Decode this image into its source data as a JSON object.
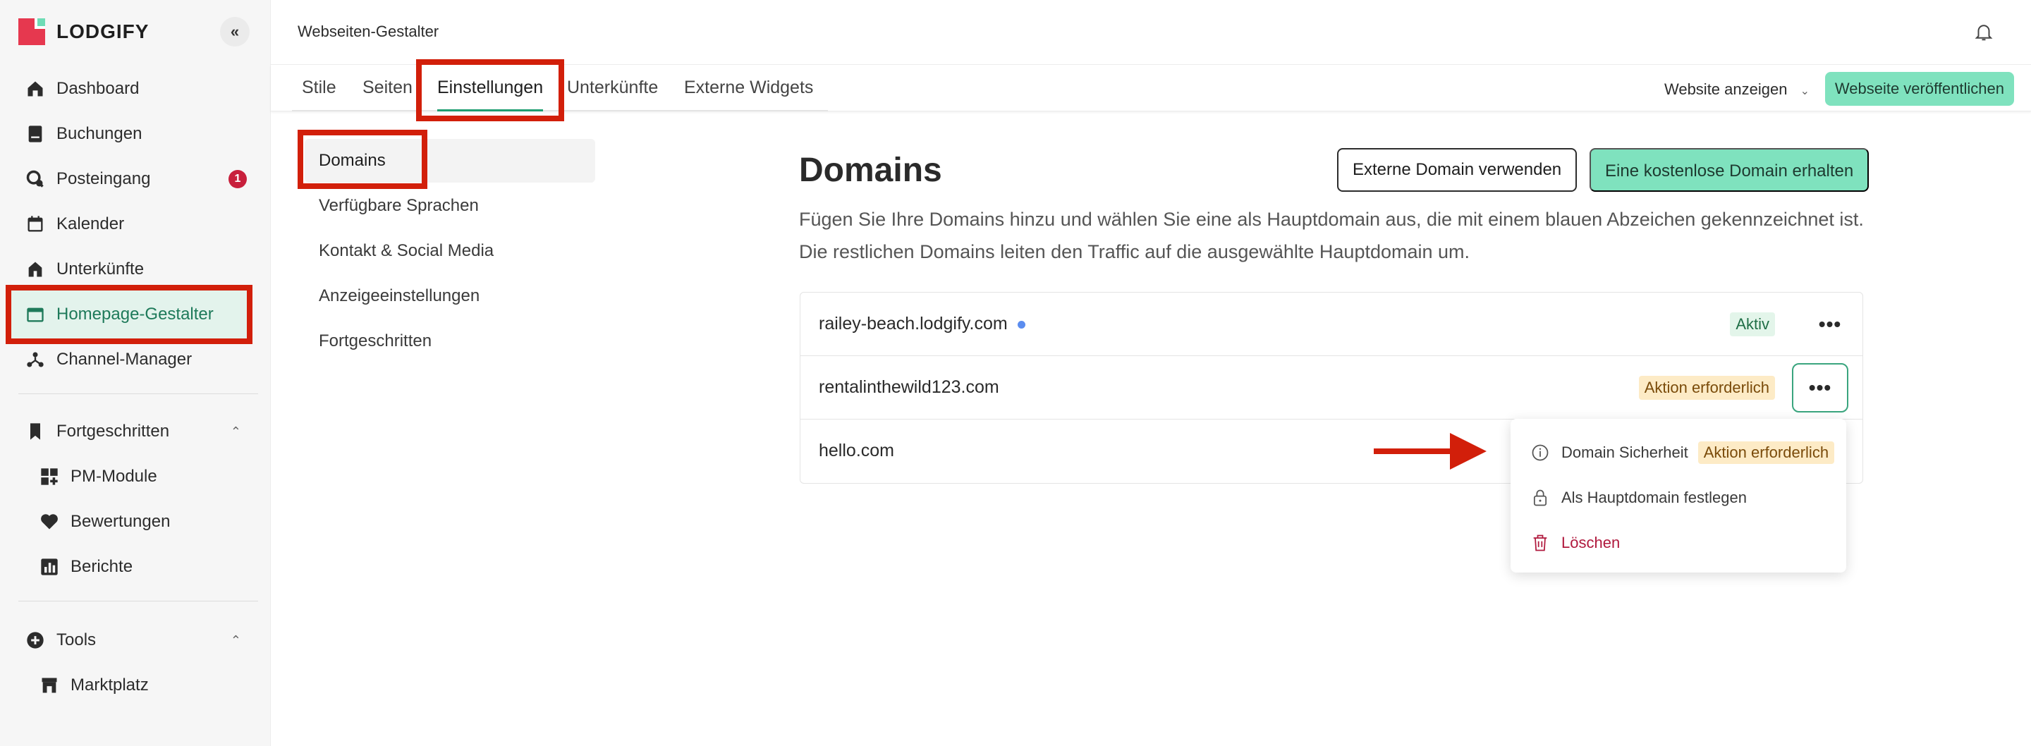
{
  "app": {
    "logo_text": "LODGIFY",
    "brand_colors": {
      "red": "#e6384f",
      "green": "#7fe2be",
      "highlight": "#d21f0a"
    }
  },
  "sidebar": {
    "collapse_icon": "chevrons-left-icon",
    "items": [
      {
        "label": "Dashboard",
        "icon": "home-icon"
      },
      {
        "label": "Buchungen",
        "icon": "book-icon"
      },
      {
        "label": "Posteingang",
        "icon": "chat-icon",
        "badge": "1"
      },
      {
        "label": "Kalender",
        "icon": "calendar-icon"
      },
      {
        "label": "Unterkünfte",
        "icon": "house-icon"
      },
      {
        "label": "Homepage-Gestalter",
        "icon": "browser-icon",
        "active": true
      },
      {
        "label": "Channel-Manager",
        "icon": "network-icon"
      }
    ],
    "sections": [
      {
        "label": "Fortgeschritten",
        "icon": "bookmark-icon",
        "items": [
          {
            "label": "PM-Module",
            "icon": "grid-plus-icon"
          },
          {
            "label": "Bewertungen",
            "icon": "heart-icon"
          },
          {
            "label": "Berichte",
            "icon": "bar-chart-icon"
          }
        ]
      },
      {
        "label": "Tools",
        "icon": "plus-circle-icon",
        "items": [
          {
            "label": "Marktplatz",
            "icon": "store-icon"
          }
        ]
      }
    ]
  },
  "header": {
    "page_name": "Webseiten-Gestalter",
    "tabs": [
      "Stile",
      "Seiten",
      "Einstellungen",
      "Unterkünfte",
      "Externe Widgets"
    ],
    "active_tab": "Einstellungen",
    "view_site_label": "Website anzeigen",
    "publish_label": "Webseite veröffentlichen"
  },
  "settings_nav": {
    "items": [
      "Domains",
      "Verfügbare Sprachen",
      "Kontakt & Social Media",
      "Anzeigeeinstellungen",
      "Fortgeschritten"
    ],
    "active": "Domains"
  },
  "main": {
    "title": "Domains",
    "external_domain_label": "Externe Domain verwenden",
    "free_domain_label": "Eine kostenlose Domain erhalten",
    "description": "Fügen Sie Ihre Domains hinzu und wählen Sie eine als Hauptdomain aus, die mit einem blauen Abzeichen gekennzeichnet ist. Die restlichen Domains leiten den Traffic auf die ausgewählte Hauptdomain um.",
    "domains": [
      {
        "name": "railey-beach.lodgify.com",
        "primary": true,
        "status": "Aktiv"
      },
      {
        "name": "rentalinthewild123.com",
        "status": "Aktion erforderlich"
      },
      {
        "name": "hello.com"
      }
    ]
  },
  "menu": {
    "items": [
      {
        "label": "Domain Sicherheit",
        "icon": "info-circle-icon",
        "badge": "Aktion erforderlich"
      },
      {
        "label": "Als Hauptdomain festlegen",
        "icon": "lock-icon"
      },
      {
        "label": "Löschen",
        "icon": "trash-icon"
      }
    ]
  }
}
